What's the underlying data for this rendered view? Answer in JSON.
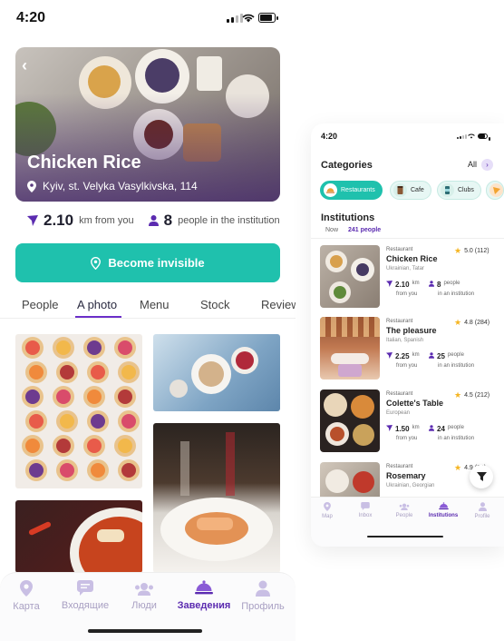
{
  "left": {
    "status": {
      "time": "4:20"
    },
    "hero": {
      "title": "Chicken Rice",
      "address": "Kyiv, st. Velyka Vasylkivska, 114"
    },
    "stats": {
      "distance_value": "2.10",
      "distance_label": "km from you",
      "people_value": "8",
      "people_label": "people in the institution"
    },
    "button": {
      "label": "Become invisible"
    },
    "tabs": [
      "People",
      "A photo",
      "Menu",
      "Stock",
      "Review"
    ],
    "active_tab": "A photo",
    "tabbar": {
      "items": [
        {
          "label": "Карта",
          "icon": "map-pin-icon"
        },
        {
          "label": "Входящие",
          "icon": "chat-icon"
        },
        {
          "label": "Люди",
          "icon": "people-icon"
        },
        {
          "label": "Заведения",
          "icon": "cloche-icon"
        },
        {
          "label": "Профиль",
          "icon": "person-icon"
        }
      ],
      "active": "Заведения"
    }
  },
  "right": {
    "status": {
      "time": "4:20"
    },
    "categories": {
      "title": "Categories",
      "all_label": "All",
      "chips": [
        "Restaurants",
        "Cafe",
        "Clubs"
      ],
      "active": "Restaurants"
    },
    "institutions": {
      "title": "Institutions",
      "now_label": "Now",
      "people_count": "241 people",
      "cards": [
        {
          "type": "Restaurant",
          "name": "Chicken Rice",
          "cuisine": "Ukrainian, Tatar",
          "rating": "5.0 (112)",
          "km": "2.10",
          "km_unit": "km",
          "from_you": "from you",
          "people": "8",
          "people_unit": "people",
          "in_inst": "in an institution"
        },
        {
          "type": "Restaurant",
          "name": "The pleasure",
          "cuisine": "Italian, Spanish",
          "rating": "4.8 (284)",
          "km": "2.25",
          "km_unit": "km",
          "from_you": "from you",
          "people": "25",
          "people_unit": "people",
          "in_inst": "in an institution"
        },
        {
          "type": "Restaurant",
          "name": "Colette's Table",
          "cuisine": "European",
          "rating": "4.5 (212)",
          "km": "1.50",
          "km_unit": "km",
          "from_you": "from you",
          "people": "24",
          "people_unit": "people",
          "in_inst": "in an institution"
        },
        {
          "type": "Restaurant",
          "name": "Rosemary",
          "cuisine": "Ukrainian, Georgian",
          "rating": "4.9 (24)"
        }
      ]
    },
    "tabbar": {
      "items": [
        "Map",
        "Inbox",
        "People",
        "Institutions",
        "Profile"
      ],
      "active": "Institutions"
    }
  },
  "colors": {
    "accent": "#1fc1ad",
    "brand": "#5b2bb0",
    "star": "#f5b521"
  }
}
